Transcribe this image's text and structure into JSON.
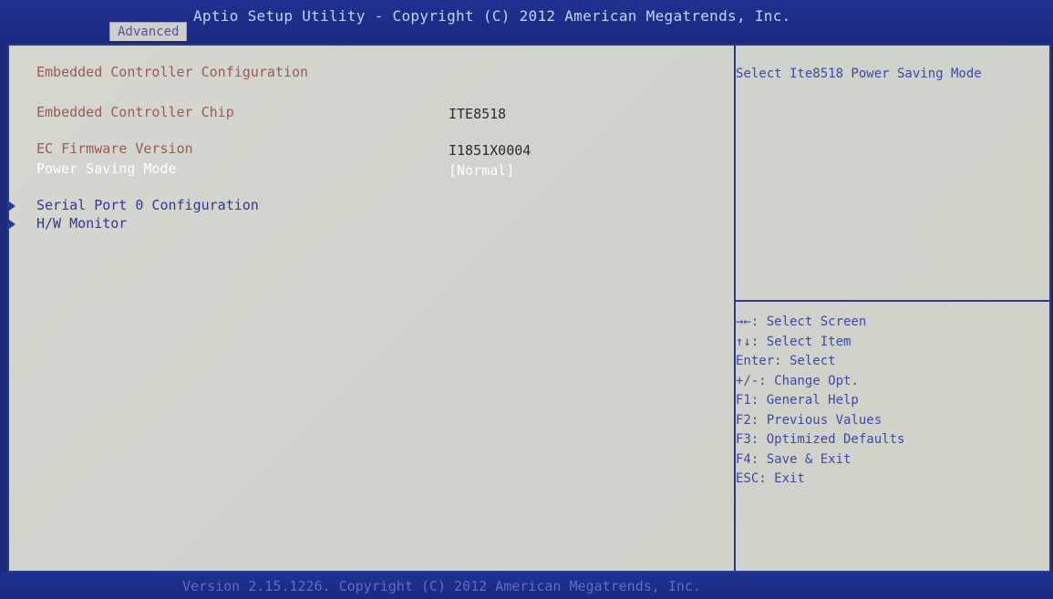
{
  "header": {
    "title": "Aptio Setup Utility - Copyright (C) 2012 American Megatrends, Inc.",
    "active_tab": "Advanced"
  },
  "main": {
    "section_title": "Embedded Controller Configuration",
    "items": [
      {
        "label": "Embedded Controller Chip",
        "value": "ITE8518"
      },
      {
        "label": "EC Firmware Version",
        "value": "I1851X0004"
      },
      {
        "label": "Power Saving Mode",
        "value": "[Normal]"
      }
    ],
    "submenus": [
      {
        "label": "Serial Port 0 Configuration"
      },
      {
        "label": "H/W Monitor"
      }
    ]
  },
  "help": {
    "description": "Select Ite8518 Power Saving Mode",
    "keys": [
      "→←: Select Screen",
      "↑↓: Select Item",
      "Enter: Select",
      "+/-: Change Opt.",
      "F1: General Help",
      "F2: Previous Values",
      "F3: Optimized Defaults",
      "F4: Save & Exit",
      "ESC: Exit"
    ]
  },
  "footer": {
    "text": "Version 2.15.1226. Copyright (C) 2012 American Megatrends, Inc."
  },
  "colors": {
    "header_bg": "#1f3190",
    "panel_bg": "#d6d6cf",
    "selected_text": "#ffffff",
    "label_text": "#9d5a55",
    "help_text": "#3a4aa8"
  }
}
